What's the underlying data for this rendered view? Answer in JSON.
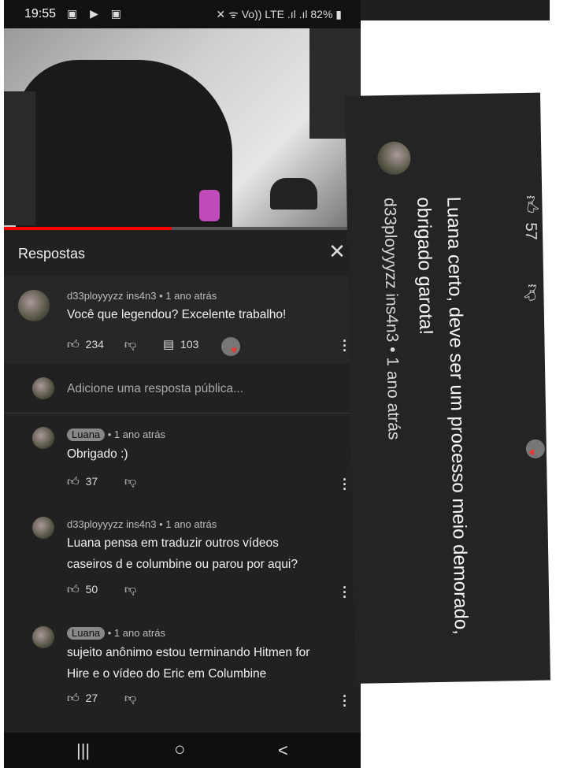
{
  "status_bar": {
    "time": "19:55",
    "left_icons": "▣ ▶ ▣",
    "right_icons": "✕ ᯤ Vo)) LTE .ıl .ıl",
    "battery": "82%"
  },
  "video": {
    "progress_percent": 47
  },
  "panel": {
    "title": "Respostas",
    "close_icon": "close-icon"
  },
  "parent_comment": {
    "author": "d33ployyyzz ins4n3",
    "time": " • 1 ano atrás",
    "text": "Você que legendou? Excelente trabalho!",
    "likes": "234",
    "replies": "103"
  },
  "reply_input": {
    "placeholder": "Adicione uma resposta pública..."
  },
  "replies": [
    {
      "author": "Luana",
      "badge": true,
      "time": " • 1 ano atrás",
      "text": "Obrigado :)",
      "likes": "37"
    },
    {
      "author": "d33ployyyzz ins4n3",
      "badge": false,
      "time": " • 1 ano atrás",
      "text_lines": [
        "Luana pensa em traduzir outros vídeos",
        "caseiros d e columbine ou parou por aqui?"
      ],
      "likes": "50"
    },
    {
      "author": "Luana",
      "badge": true,
      "time": " • 1 ano atrás",
      "text_lines": [
        "sujeito anônimo estou terminando Hitmen for",
        "Hire e o vídeo do Eric em Columbine"
      ],
      "likes": "27"
    }
  ],
  "rotated_comment": {
    "author": "d33ployyyzz ins4n3",
    "time": " • 1 ano atrás",
    "text": "Luana certo, deve ser um processo meio demorado, obrigado garota!",
    "likes": "57"
  },
  "nav_bar": {
    "recent": "|||",
    "home": "○",
    "back": "<"
  }
}
